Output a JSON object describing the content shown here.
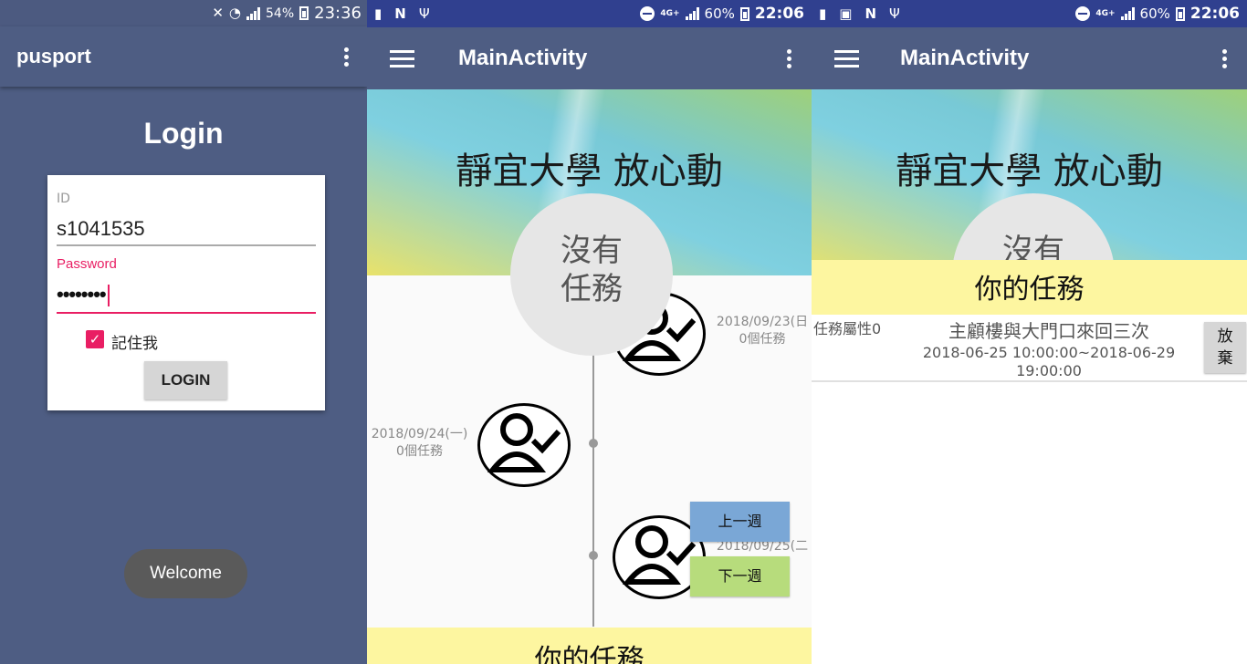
{
  "screen1": {
    "status": {
      "time": "23:36",
      "battery": "54%"
    },
    "app_title": "pusport",
    "login_heading": "Login",
    "id_label": "ID",
    "id_value": "s1041535",
    "password_label": "Password",
    "password_value": "••••••••",
    "remember_label": "記住我",
    "remember_checked": true,
    "login_button": "LOGIN",
    "toast": "Welcome",
    "colors": {
      "background": "#4e5d83",
      "accent": "#e91e63"
    }
  },
  "screen2": {
    "status": {
      "time": "22:06",
      "battery": "60%",
      "network": "4G+"
    },
    "app_title": "MainActivity",
    "header_title": "靜宜大學 放心動",
    "no_task_line1": "沒有",
    "no_task_line2": "任務",
    "timeline": [
      {
        "date": "2018/09/23(日",
        "count": "0個任務",
        "side": "right"
      },
      {
        "date": "2018/09/24(一)",
        "count": "0個任務",
        "side": "left"
      },
      {
        "date": "2018/09/25(二",
        "count": "",
        "side": "right"
      }
    ],
    "prev_week_button": "上一週",
    "next_week_button": "下一週",
    "your_tasks": "你的任務",
    "colors": {
      "prev": "#7aa7d6",
      "next": "#b7dc7c",
      "band": "#fdf6a0"
    }
  },
  "screen3": {
    "status": {
      "time": "22:06",
      "battery": "60%",
      "network": "4G+"
    },
    "app_title": "MainActivity",
    "header_title": "靜宜大學 放心動",
    "no_task_partial": "沒有",
    "your_tasks": "你的任務",
    "task": {
      "attribute": "任務屬性0",
      "name": "主顧樓與大門口來回三次",
      "time_range": "2018-06-25 10:00:00~2018-06-29 19:00:00",
      "give_up_line1": "放",
      "give_up_line2": "棄"
    }
  }
}
